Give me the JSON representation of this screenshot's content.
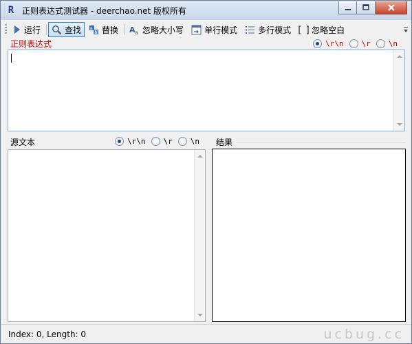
{
  "window": {
    "title": "正则表达式测试器 - deerchao.net 版权所有",
    "app_icon_glyph": "R"
  },
  "toolbar": {
    "items": [
      {
        "label": "运行",
        "icon": "play-icon",
        "active": false
      },
      {
        "label": "查找",
        "icon": "search-icon",
        "active": true
      },
      {
        "label": "替换",
        "icon": "replace-icon",
        "active": false
      },
      {
        "label": "忽略大小写",
        "icon": "case-icon",
        "active": false
      },
      {
        "label": "单行模式",
        "icon": "single-line-icon",
        "active": false
      },
      {
        "label": "多行模式",
        "icon": "multi-line-icon",
        "active": false
      },
      {
        "label": "忽略空白",
        "icon": "whitespace-icon",
        "active": false
      }
    ]
  },
  "regex": {
    "label": "正则表达式",
    "value": "",
    "newline_options": [
      {
        "label": "\\r\\n",
        "selected": true
      },
      {
        "label": "\\r",
        "selected": false
      },
      {
        "label": "\\n",
        "selected": false
      }
    ]
  },
  "source": {
    "label": "源文本",
    "value": "",
    "newline_options": [
      {
        "label": "\\r\\n",
        "selected": true
      },
      {
        "label": "\\r",
        "selected": false
      },
      {
        "label": "\\n",
        "selected": false
      }
    ]
  },
  "result": {
    "label": "结果"
  },
  "status": {
    "text": "Index: 0, Length: 0"
  },
  "watermark": {
    "text": "ucbug.cc"
  },
  "colors": {
    "regex_label": "#c00000",
    "focus_border": "#7fb0d8",
    "active_button_border": "#3c7fb1"
  }
}
